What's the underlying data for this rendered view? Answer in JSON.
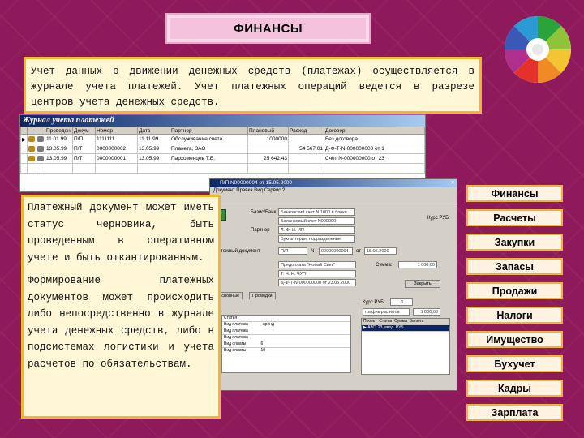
{
  "title": "ФИНАНСЫ",
  "intro_text": "Учет данных о движении денежных средств (платежах) осуществляется в журнале учета платежей. Учет платежных операций ведется в разрезе центров учета денежных средств.",
  "journal": {
    "caption": "Журнал учета платежей",
    "columns": [
      "",
      "",
      "",
      "Проведен",
      "Докум",
      "Номер",
      "Дата",
      "Партнер",
      "Плановый",
      "Расход",
      "Договор"
    ],
    "rows": [
      [
        "",
        "",
        "",
        "11.01.99",
        "П/П",
        "1111111",
        "11.11.99",
        "Обслуживание счета",
        "1000000",
        "",
        "Без договора"
      ],
      [
        "",
        "",
        "",
        "13.05.99",
        "П/Т",
        "0000000002",
        "13.05.99",
        "Планета, ЗАО",
        "",
        "54 567.01",
        "Д-Ф-Т-N-000000000 от 1"
      ],
      [
        "",
        "",
        "",
        "13.05.99",
        "П/Т",
        "0000000001",
        "13.05.99",
        "Пархоменцев Т.Е.",
        "25 642.43",
        "",
        "Счет N-000000000 от 23"
      ]
    ]
  },
  "document_window": {
    "caption": "П/П N00000004 от 15.05.2000",
    "menu": "Документ  Правка  Вид  Сервис  ?",
    "labels": {
      "base": "Базис/Банк",
      "partner": "Партнер",
      "payment_doc": "Платежный документ",
      "number_label": "N",
      "date_label": "от",
      "sum_label": "Сумма:",
      "rub": "РУБ",
      "rate": "Курс РУБ:",
      "rate_value": "1",
      "schedule": "график расчетов"
    },
    "fields": {
      "bank": "Банковский счет N 1000 в банке",
      "bank2": "Балансовый счет N000000",
      "partner": "Л. Ф. И. ИП",
      "partner2": "Бухгалтерия, подразделение",
      "doc_type": "П/П",
      "doc_number": "00000000004",
      "doc_date": "15.05.2000",
      "note1": "Предоплата \"Новый Свет\"",
      "note2": "Т. Н. Н. ЧУП",
      "note3": "Д-Ф-Т-N-000000000 от 23.05.2000",
      "amount": "1 000,00",
      "amount2": "1 000,00"
    },
    "buttons": {
      "btn1": "Сервис",
      "btn2": "Провести",
      "btn3": "Закрыть"
    },
    "tabs": [
      "Основные",
      "Проводки"
    ],
    "grid_rows": [
      "Статья",
      "Вид платежа",
      "Вид платежа",
      "Вид платежа",
      "Вид оплаты",
      "Вид оплаты"
    ],
    "grid_vals": [
      "",
      "аренд",
      "",
      "",
      "6",
      "10"
    ],
    "grid2_header": [
      "Проект",
      "Статья",
      "Сумма",
      "Валюта"
    ],
    "grid2_row": [
      "▶",
      "АЗС",
      "23",
      "ввод",
      "РУБ"
    ]
  },
  "left_text": [
    "Платежный документ может иметь статус черновика, быть проведенным в оперативном учете и быть откантированным.",
    "Формирование платежных документов может происходить либо непосредственно в журнале учета денежных средств, либо в подсистемах логистики и учета расчетов по обязательствам."
  ],
  "nav": [
    "Финансы",
    "Расчеты",
    "Закупки",
    "Запасы",
    "Продажи",
    "Налоги",
    "Имущество",
    "Бухучет",
    "Кадры",
    "Зарплата"
  ],
  "colors": {
    "background": "#8e1a5b",
    "title_bg": "#f4c2dd",
    "text_box_bg": "#fff7d6",
    "text_box_border": "#f0b531",
    "nav_bg": "#fff2e0",
    "nav_border": "#f1b13a"
  }
}
